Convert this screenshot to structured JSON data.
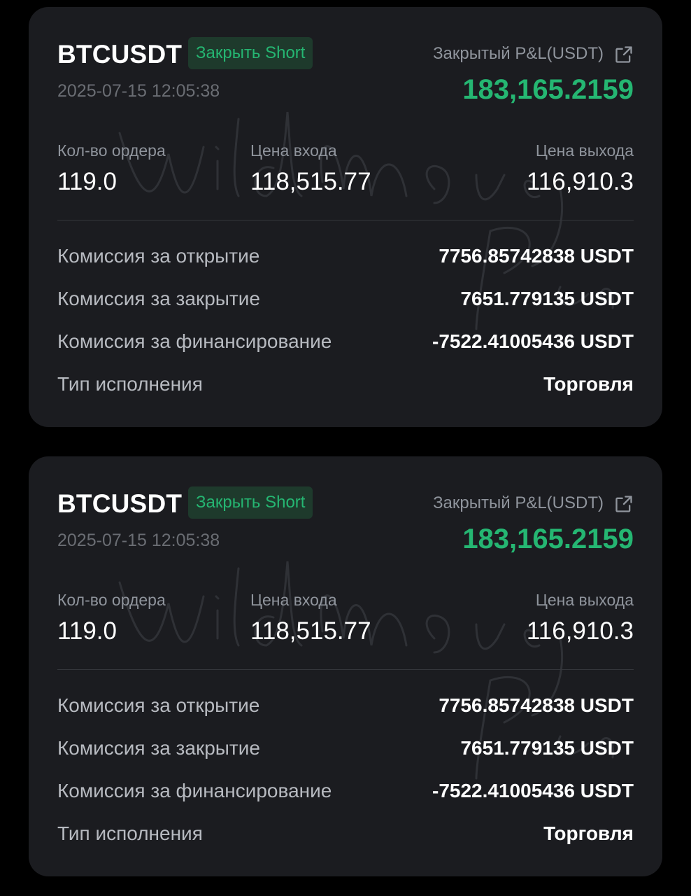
{
  "trades": [
    {
      "symbol": "BTCUSDT",
      "badge": "Закрыть Short",
      "datetime": "2025-07-15 12:05:38",
      "pnl_label": "Закрытый P&L(USDT)",
      "pnl_value": "183,165.2159",
      "qty_label": "Кол-во ордера",
      "qty_value": "119.0",
      "entry_label": "Цена входа",
      "entry_value": "118,515.77",
      "exit_label": "Цена выхода",
      "exit_value": "116,910.3",
      "rows": [
        {
          "label": "Комиссия за открытие",
          "value": "7756.85742838 USDT"
        },
        {
          "label": "Комиссия за закрытие",
          "value": "7651.779135 USDT"
        },
        {
          "label": "Комиссия за финансирование",
          "value": "-7522.41005436 USDT"
        },
        {
          "label": "Тип исполнения",
          "value": "Торговля"
        }
      ]
    },
    {
      "symbol": "BTCUSDT",
      "badge": "Закрыть Short",
      "datetime": "2025-07-15 12:05:38",
      "pnl_label": "Закрытый P&L(USDT)",
      "pnl_value": "183,165.2159",
      "qty_label": "Кол-во ордера",
      "qty_value": "119.0",
      "entry_label": "Цена входа",
      "entry_value": "118,515.77",
      "exit_label": "Цена выхода",
      "exit_value": "116,910.3",
      "rows": [
        {
          "label": "Комиссия за открытие",
          "value": "7756.85742838 USDT"
        },
        {
          "label": "Комиссия за закрытие",
          "value": "7651.779135 USDT"
        },
        {
          "label": "Комиссия за финансирование",
          "value": "-7522.41005436 USDT"
        },
        {
          "label": "Тип исполнения",
          "value": "Торговля"
        }
      ]
    }
  ],
  "watermark_text": "Wild Money Pro",
  "colors": {
    "background": "#000000",
    "card": "#1b1c20",
    "profit_green": "#25b672",
    "badge_bg": "#1e3a2c",
    "muted_text": "#8f949c"
  },
  "icons": {
    "external_link": "external-link-icon"
  }
}
